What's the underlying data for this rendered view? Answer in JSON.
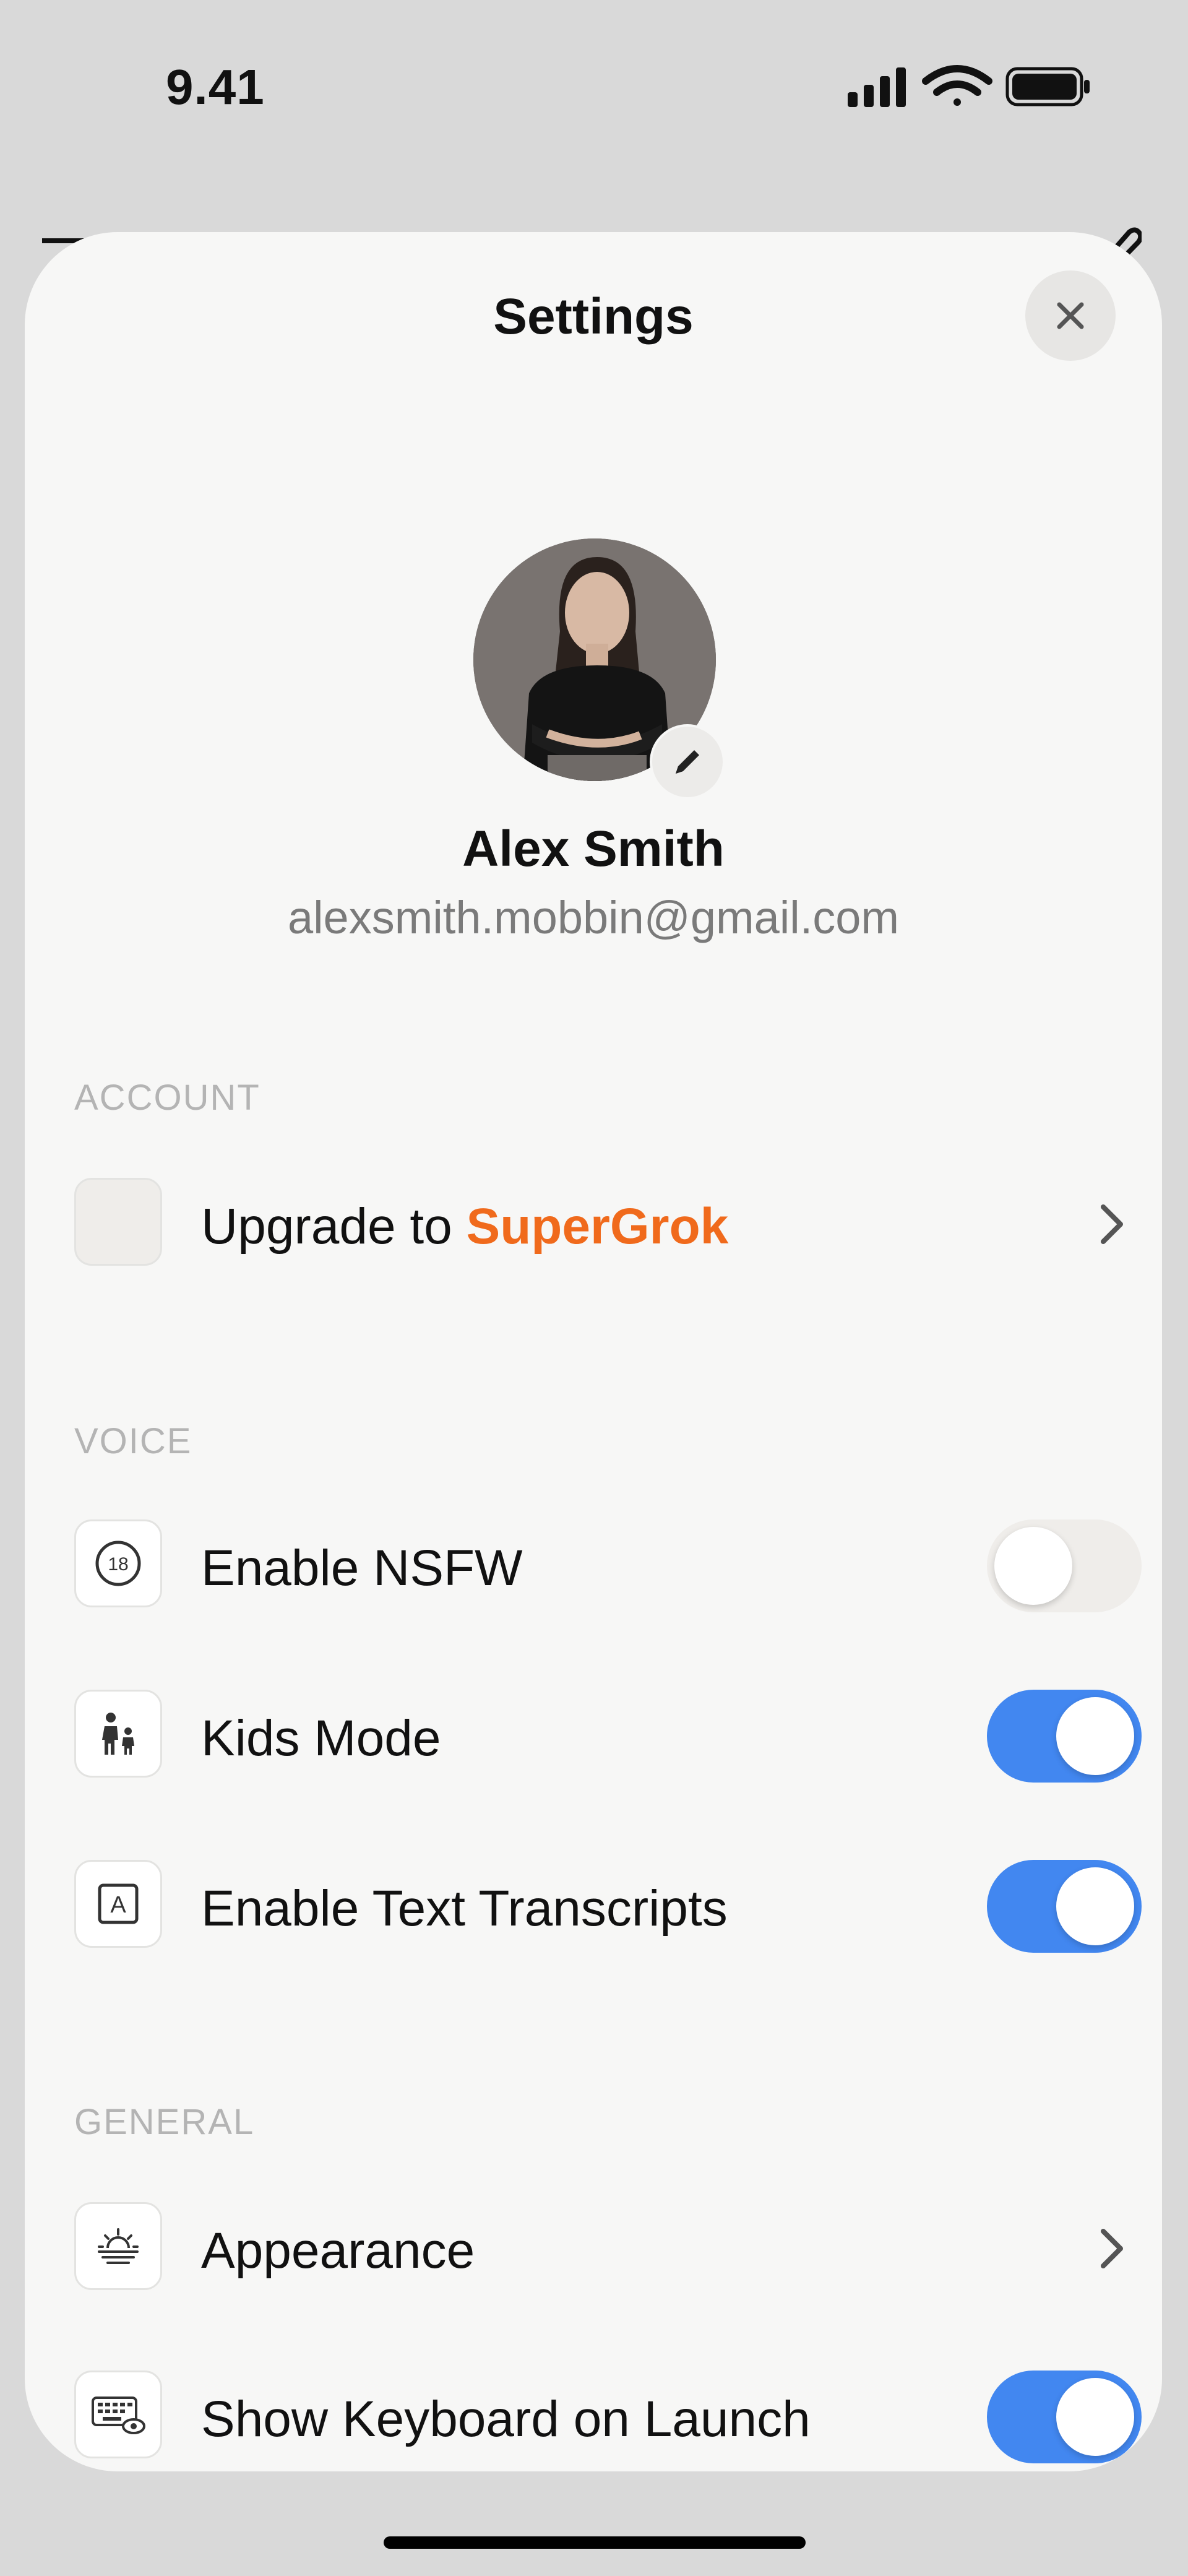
{
  "status_bar": {
    "time": "9.41"
  },
  "header": {
    "title": "Settings"
  },
  "profile": {
    "name": "Alex Smith",
    "email": "alexsmith.mobbin@gmail.com"
  },
  "sections": {
    "account": {
      "label": "ACCOUNT",
      "upgrade": {
        "prefix": "Upgrade to ",
        "highlight": "SuperGrok"
      }
    },
    "voice": {
      "label": "VOICE",
      "enable_nsfw": {
        "label": "Enable NSFW",
        "badge": "18",
        "enabled": false
      },
      "kids_mode": {
        "label": "Kids Mode",
        "enabled": true
      },
      "text_transcripts": {
        "label": "Enable Text Transcripts",
        "badge": "A",
        "enabled": true
      }
    },
    "general": {
      "label": "GENERAL",
      "appearance": {
        "label": "Appearance"
      },
      "show_keyboard": {
        "label": "Show Keyboard on Launch",
        "enabled": true
      }
    }
  },
  "icons": {
    "close": "close-icon",
    "edit": "pencil-icon",
    "upgrade": "blank-tile-icon",
    "nsfw": "age-18-icon",
    "kids": "parent-child-icon",
    "transcripts": "text-box-icon",
    "appearance": "sunrise-icon",
    "keyboard": "keyboard-eye-icon",
    "chevron": "chevron-right-icon"
  },
  "colors": {
    "accent": "#f06a1c",
    "toggle_on": "#4287f0",
    "toggle_off": "#efedea"
  }
}
